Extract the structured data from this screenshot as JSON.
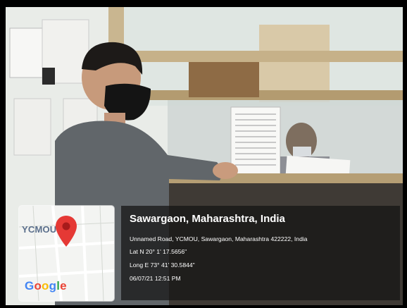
{
  "photo": {
    "subject": ""
  },
  "map_tile": {
    "place_label": "YCMOU",
    "google_logo": [
      "G",
      "o",
      "o",
      "g",
      "l",
      "e"
    ],
    "pin_color": "#E53935"
  },
  "geotag": {
    "title": "Sawargaon, Maharashtra, India",
    "address": "Unnamed Road, YCMOU, Sawargaon, Maharashtra 422222, India",
    "latitude": "Lat N 20° 1' 17.5656\"",
    "longitude": "Long E 73° 41' 30.5844\"",
    "timestamp": "06/07/21 12:51 PM"
  }
}
